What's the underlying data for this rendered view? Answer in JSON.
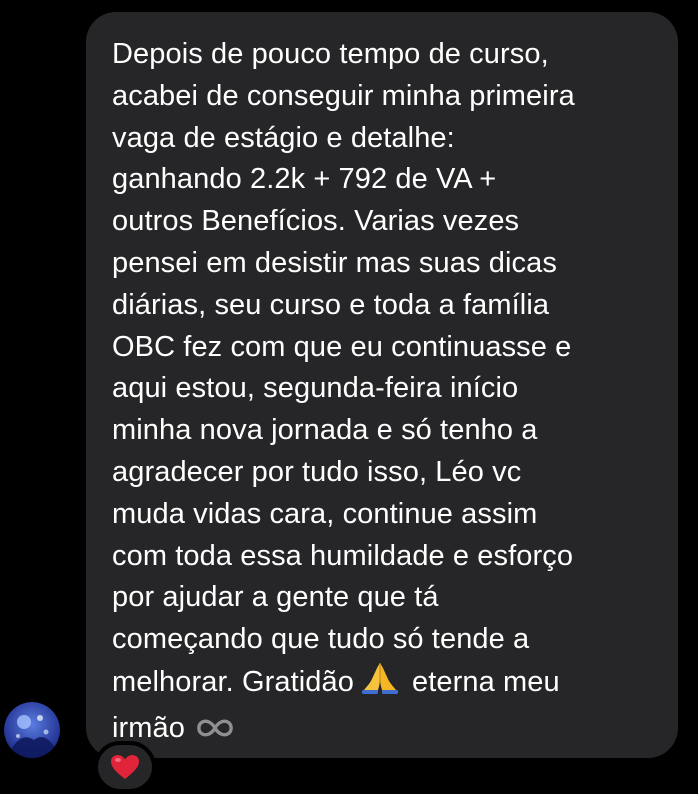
{
  "message": {
    "lines": [
      "Depois de pouco tempo de curso,",
      "acabei de conseguir minha primeira",
      "vaga de estágio e detalhe:",
      "ganhando 2.2k + 792 de VA +",
      "outros Benefícios. Varias vezes",
      "pensei em desistir mas suas dicas",
      "diárias, seu curso e toda a família",
      "OBC fez com que eu continuasse e",
      "aqui estou, segunda-feira início",
      "minha nova jornada e só tenho a",
      "agradecer por tudo isso, Léo vc",
      "muda vidas cara, continue assim",
      "com toda essa humildade e esforço",
      "por ajudar a gente que tá",
      "começando que tudo só tende a"
    ],
    "line_16_before_emoji": "melhorar. Gratidão",
    "line_16_after_emoji": "eterna  meu",
    "line_17": "irmão",
    "emoji_1": "folded-hands-emoji",
    "emoji_2": "infinity-emoji"
  },
  "sender_avatar": "avatar-icon",
  "reaction": {
    "icon": "red-heart-icon",
    "color": "#e0243a"
  },
  "colors": {
    "background": "#000000",
    "bubble": "#262628",
    "text": "#ffffff"
  }
}
